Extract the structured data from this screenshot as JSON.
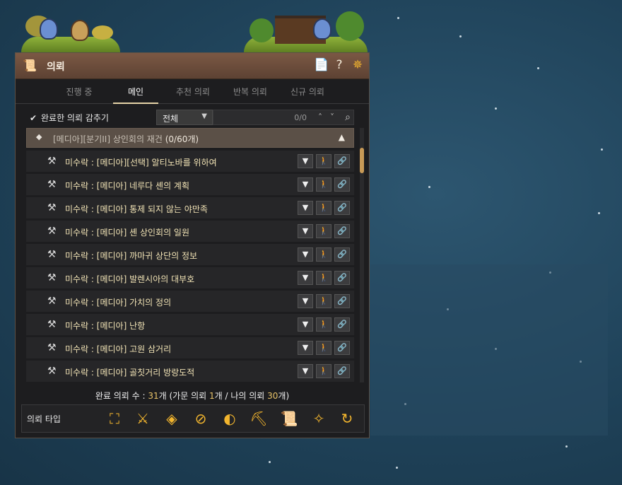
{
  "window": {
    "title": "의뢰",
    "buttons": {
      "doc_icon": "📄",
      "help": "?",
      "settings_icon": "✵"
    }
  },
  "tabs": [
    {
      "label": "진행 중",
      "active": false
    },
    {
      "label": "메인",
      "active": true
    },
    {
      "label": "추천 의뢰",
      "active": false
    },
    {
      "label": "반복 의뢰",
      "active": false
    },
    {
      "label": "신규 의뢰",
      "active": false
    }
  ],
  "filter": {
    "hide_completed_label": "완료한 의뢰 감추기",
    "hide_completed_checked": true,
    "category_selected": "전체",
    "search_count": "0/0"
  },
  "group": {
    "name": "[메디아][분기II] 상인회의 재건",
    "count": "(0/60개)"
  },
  "quests": [
    {
      "name": "미수락 : [메디아][선택] 알티노바를 위하여"
    },
    {
      "name": "미수락 : [메디아] 네루다 셴의 계획"
    },
    {
      "name": "미수락 : [메디아] 통제 되지 않는 야만족"
    },
    {
      "name": "미수락 : [메디아] 셴 상인회의 일원"
    },
    {
      "name": "미수락 : [메디아] 까마귀 상단의 정보"
    },
    {
      "name": "미수락 : [메디아] 발렌시아의 대부호"
    },
    {
      "name": "미수락 : [메디아] 가치의 정의"
    },
    {
      "name": "미수락 : [메디아] 난항"
    },
    {
      "name": "미수락 : [메디아] 고원 삼거리"
    },
    {
      "name": "미수락 : [메디아] 골칫거리 방랑도적"
    }
  ],
  "row_buttons": {
    "expand": "▼",
    "navigate": "🚶",
    "link": "🔗"
  },
  "summary": {
    "prefix": "완료 의뢰 수 : ",
    "total": "31",
    "mid1": "개 (가문 의뢰 ",
    "family": "1",
    "mid2": "개 / 나의 의뢰 ",
    "mine": "30",
    "suffix": "개)"
  },
  "type_bar": {
    "label": "의뢰 타입",
    "icons": [
      {
        "name": "all-types-icon",
        "glyph": "⛶"
      },
      {
        "name": "combat-icon",
        "glyph": "⚔"
      },
      {
        "name": "life-icon",
        "glyph": "◈"
      },
      {
        "name": "fishing-icon",
        "glyph": "⊘"
      },
      {
        "name": "trade-icon",
        "glyph": "◐"
      },
      {
        "name": "gathering-icon",
        "glyph": "⛏"
      },
      {
        "name": "knowledge-icon",
        "glyph": "📜"
      },
      {
        "name": "adventure-icon",
        "glyph": "✧"
      },
      {
        "name": "repeat-icon",
        "glyph": "↻"
      }
    ]
  },
  "colors": {
    "accent_gold": "#e8c36a",
    "quest_text": "#f1e3b5",
    "icon_orange": "#f2b52e"
  }
}
